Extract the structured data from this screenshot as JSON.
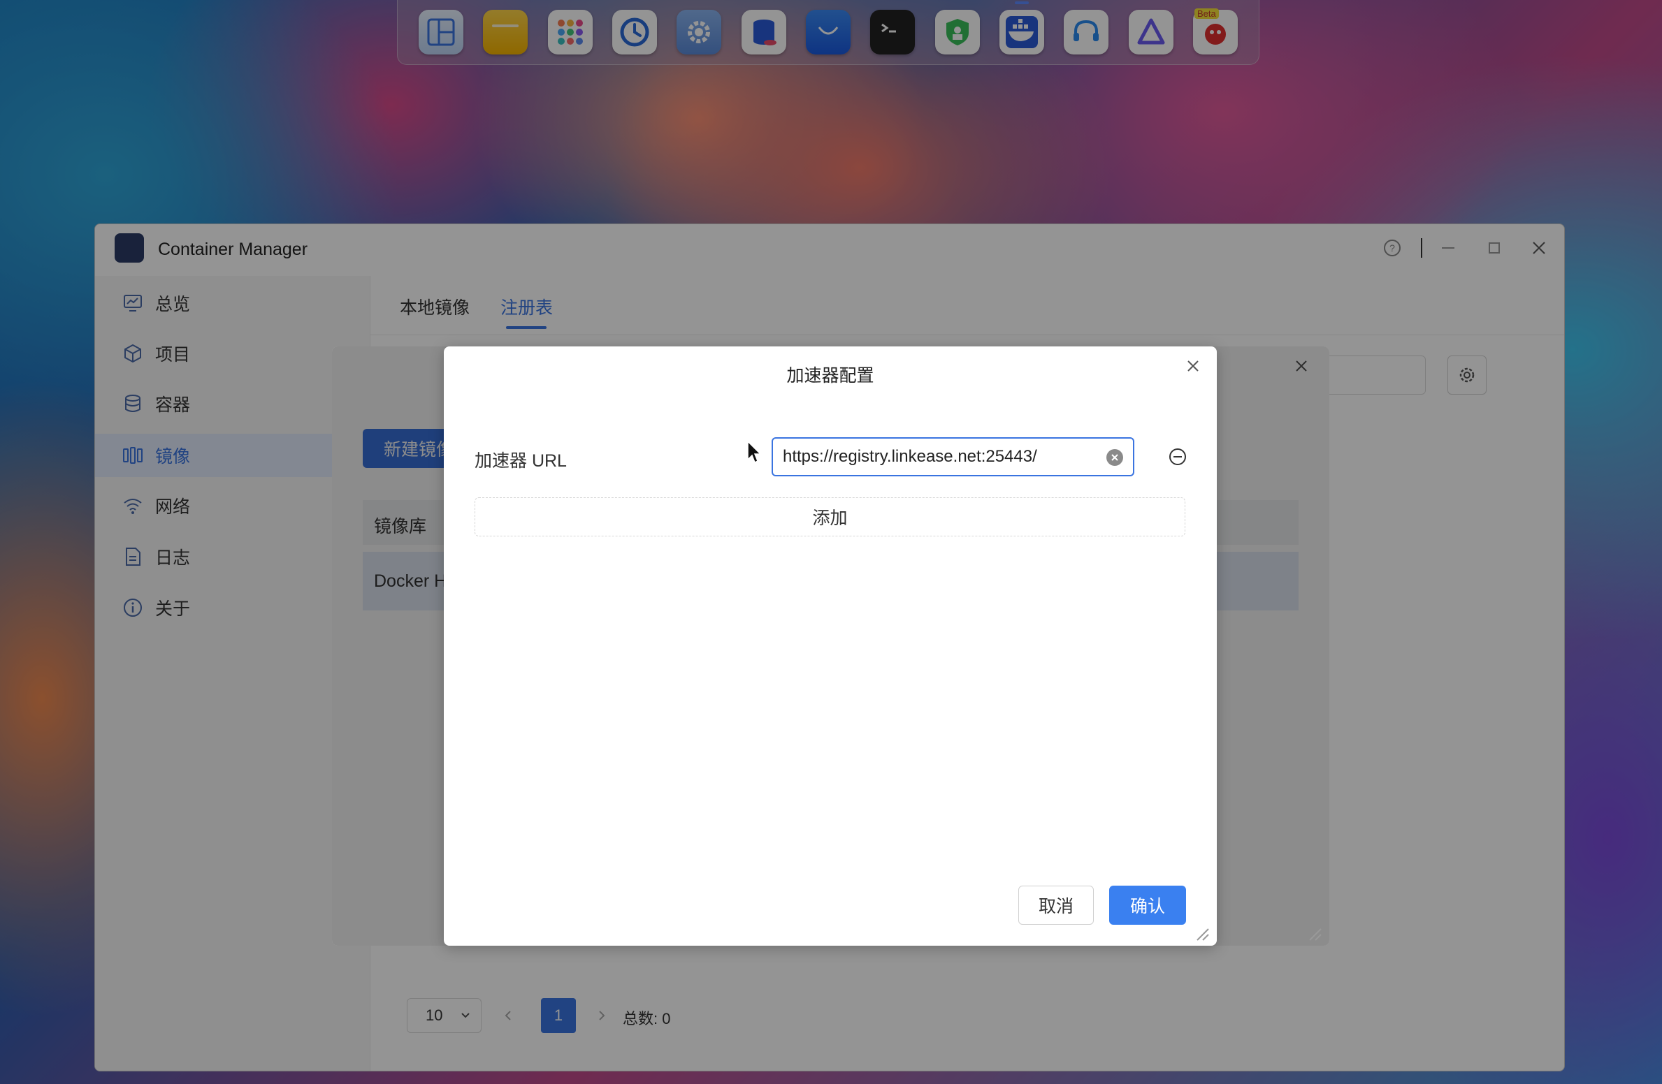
{
  "dock": {
    "items": [
      {
        "name": "window-manager-app",
        "icon": "tiles-icon"
      },
      {
        "name": "file-manager-app",
        "icon": "folder-icon"
      },
      {
        "name": "app-center-app",
        "icon": "apps-grid-icon"
      },
      {
        "name": "backup-app",
        "icon": "clock-icon"
      },
      {
        "name": "settings-app",
        "icon": "gear-icon"
      },
      {
        "name": "storage-app",
        "icon": "database-icon"
      },
      {
        "name": "store-app",
        "icon": "shopping-bag-icon"
      },
      {
        "name": "terminal-app",
        "icon": "terminal-icon"
      },
      {
        "name": "security-app",
        "icon": "shield-icon"
      },
      {
        "name": "container-manager-app",
        "icon": "docker-whale-icon"
      },
      {
        "name": "support-app",
        "icon": "headset-icon"
      },
      {
        "name": "vpn-app",
        "icon": "triangle-icon"
      },
      {
        "name": "beta-app",
        "icon": "red-bird-icon",
        "badge": "Beta"
      }
    ]
  },
  "window": {
    "title": "Container Manager"
  },
  "sidebar": {
    "items": [
      {
        "label": "总览",
        "icon": "monitor-chart-icon"
      },
      {
        "label": "项目",
        "icon": "cube-icon"
      },
      {
        "label": "容器",
        "icon": "stack-icon"
      },
      {
        "label": "镜像",
        "icon": "image-layers-icon",
        "active": true
      },
      {
        "label": "网络",
        "icon": "wifi-icon"
      },
      {
        "label": "日志",
        "icon": "document-icon"
      },
      {
        "label": "关于",
        "icon": "info-icon"
      }
    ]
  },
  "tabs": {
    "local": "本地镜像",
    "registry": "注册表"
  },
  "pagination": {
    "page_size": "10",
    "current_page": "1",
    "total": "总数: 0"
  },
  "registry_dialog": {
    "new_button": "新建镜像",
    "column_header": "镜像库",
    "row_name": "Docker Hub"
  },
  "accelerator_dialog": {
    "title": "加速器配置",
    "url_label": "加速器 URL",
    "url_value": "https://registry.linkease.net:25443/",
    "add_label": "添加",
    "cancel_label": "取消",
    "confirm_label": "确认"
  },
  "colors": {
    "accent": "#3a74e0",
    "sidebar_active_bg": "#e2ebfb"
  }
}
